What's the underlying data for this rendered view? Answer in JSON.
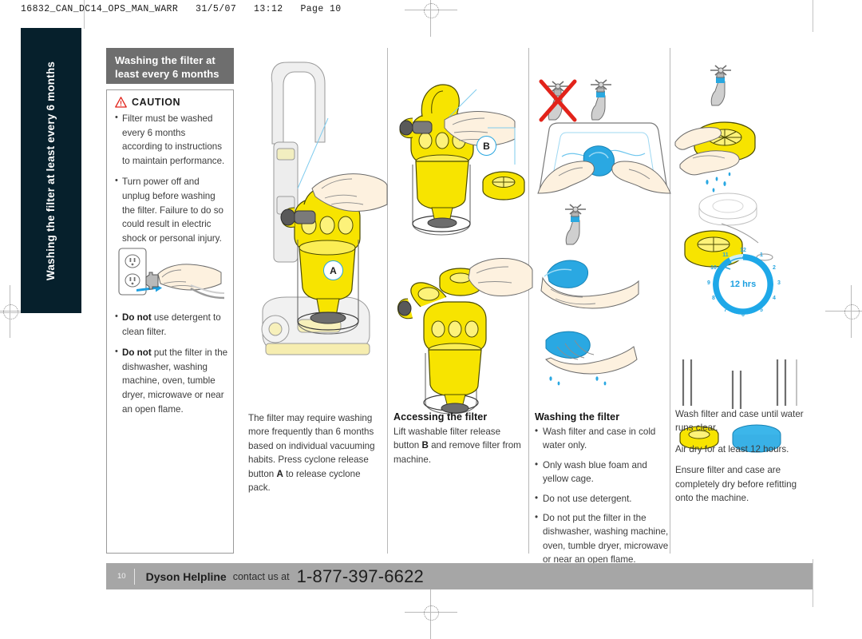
{
  "slug": "16832_CAN_DC14_OPS_MAN_WARR   31/5/07   13:12   Page 10",
  "side_tab": {
    "text": "Washing the filter at least every 6 months"
  },
  "title_box": {
    "text": "Washing the filter at least every 6 months"
  },
  "caution": {
    "icon": "warning-triangle-icon",
    "title": "CAUTION",
    "bullets": [
      "Filter must be washed every 6 months according to instructions to maintain performance.",
      "Turn power off and unplug before washing the filter. Failure to do so could result in electric shock or personal injury."
    ],
    "lower_bullets": [
      {
        "bold": "Do not",
        "rest": " use detergent to clean filter."
      },
      {
        "bold": "Do not",
        "rest": " put the filter in the dishwasher, washing machine, oven, tumble dryer, microwave or near an open flame."
      }
    ],
    "figure": "unplug-cord-from-outlet-illustration"
  },
  "callouts": {
    "a": "A",
    "b": "B"
  },
  "columns": [
    {
      "figure": "upright-vacuum-remove-cyclone-illustration",
      "heading": "",
      "paragraphs": [
        {
          "text": "The filter may require washing more frequently than 6 months based on individual vacuuming habits. Press cyclone release button ",
          "bold": "A",
          "tail": " to release cyclone pack."
        }
      ]
    },
    {
      "figure": "cyclone-pack-release-filter-illustration",
      "heading": "Accessing the filter",
      "paragraphs": [
        {
          "text": "Lift washable filter release button ",
          "bold": "B",
          "tail": " and remove filter from machine."
        }
      ]
    },
    {
      "figure": "wash-foam-filter-in-sink-illustration",
      "heading": "Washing the filter",
      "bullets": [
        "Wash filter and case in cold water only.",
        "Only wash blue foam and yellow cage.",
        "Do not use detergent.",
        "Do not put the filter in the dishwasher, washing machine, oven, tumble dryer, microwave or near an open flame."
      ]
    },
    {
      "figure": "air-dry-filter-12-hours-illustration",
      "heading": "",
      "paragraphs": [
        {
          "text": "Wash filter and case until water runs clear."
        },
        {
          "text": "Air dry for at least 12 hours."
        },
        {
          "text": "Ensure filter and case are completely dry before refitting onto the machine."
        }
      ]
    }
  ],
  "clock": {
    "label": "12 hrs",
    "numbers": [
      "12",
      "1",
      "2",
      "3",
      "4",
      "5",
      "6",
      "7",
      "8",
      "9",
      "10",
      "11"
    ]
  },
  "footer": {
    "page": "10",
    "brand": "Dyson Helpline",
    "contact": "contact us at",
    "phone": "1-877-397-6622"
  },
  "colors": {
    "tab_background": "#06202c",
    "title_background": "#6e6e6e",
    "footer_background": "#a6a6a6",
    "accent_yellow": "#f5e003",
    "accent_blue": "#2aa7e0",
    "warning_red": "#e2231a"
  }
}
